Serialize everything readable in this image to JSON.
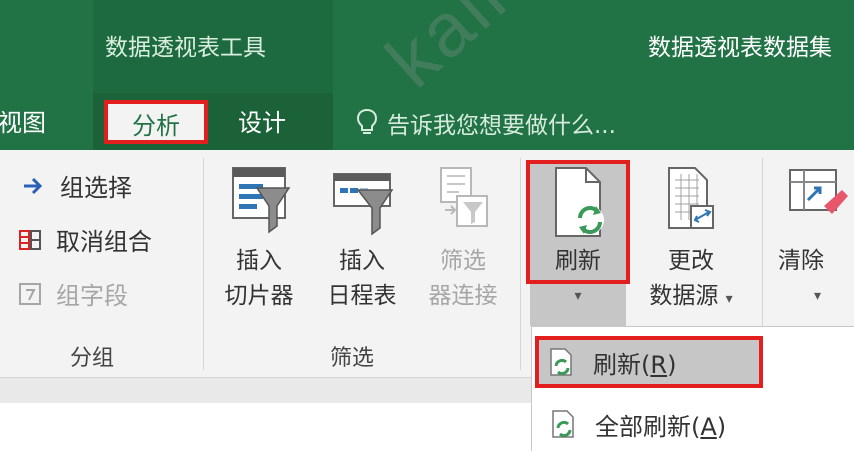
{
  "title_bar": {
    "context_title": "数据透视表工具",
    "document_title": "数据透视表数据集"
  },
  "tabs": {
    "view": "视图",
    "analyze": "分析",
    "design": "设计",
    "tell_me": "告诉我您想要做什么..."
  },
  "ribbon": {
    "group": {
      "items": [
        {
          "label": "组选择",
          "icon": "arrow-right-icon",
          "enabled": true
        },
        {
          "label": "取消组合",
          "icon": "ungroup-icon",
          "enabled": true
        },
        {
          "label": "组字段",
          "icon": "group-field-icon",
          "enabled": false
        }
      ],
      "label": "分组"
    },
    "filter": {
      "insert_slicer": [
        "插入",
        "切片器"
      ],
      "insert_timeline": [
        "插入",
        "日程表"
      ],
      "filter_connections": [
        "筛选",
        "器连接"
      ],
      "label": "筛选"
    },
    "data": {
      "refresh": "刷新",
      "change_source": [
        "更改",
        "数据源"
      ],
      "clear": "清除"
    }
  },
  "refresh_menu": {
    "items": [
      {
        "label_prefix": "刷新(",
        "accel": "R",
        "label_suffix": ")",
        "icon": "refresh-icon",
        "selected": true
      },
      {
        "label_prefix": "全部刷新(",
        "accel": "A",
        "label_suffix": ")",
        "icon": "refresh-all-icon",
        "selected": false
      }
    ]
  },
  "watermark": "kaikeba",
  "colors": {
    "excel_green": "#217346",
    "highlight_red": "#e21e1e",
    "ribbon_bg": "#f3f3f3",
    "selected_gray": "#c6c6c6"
  }
}
